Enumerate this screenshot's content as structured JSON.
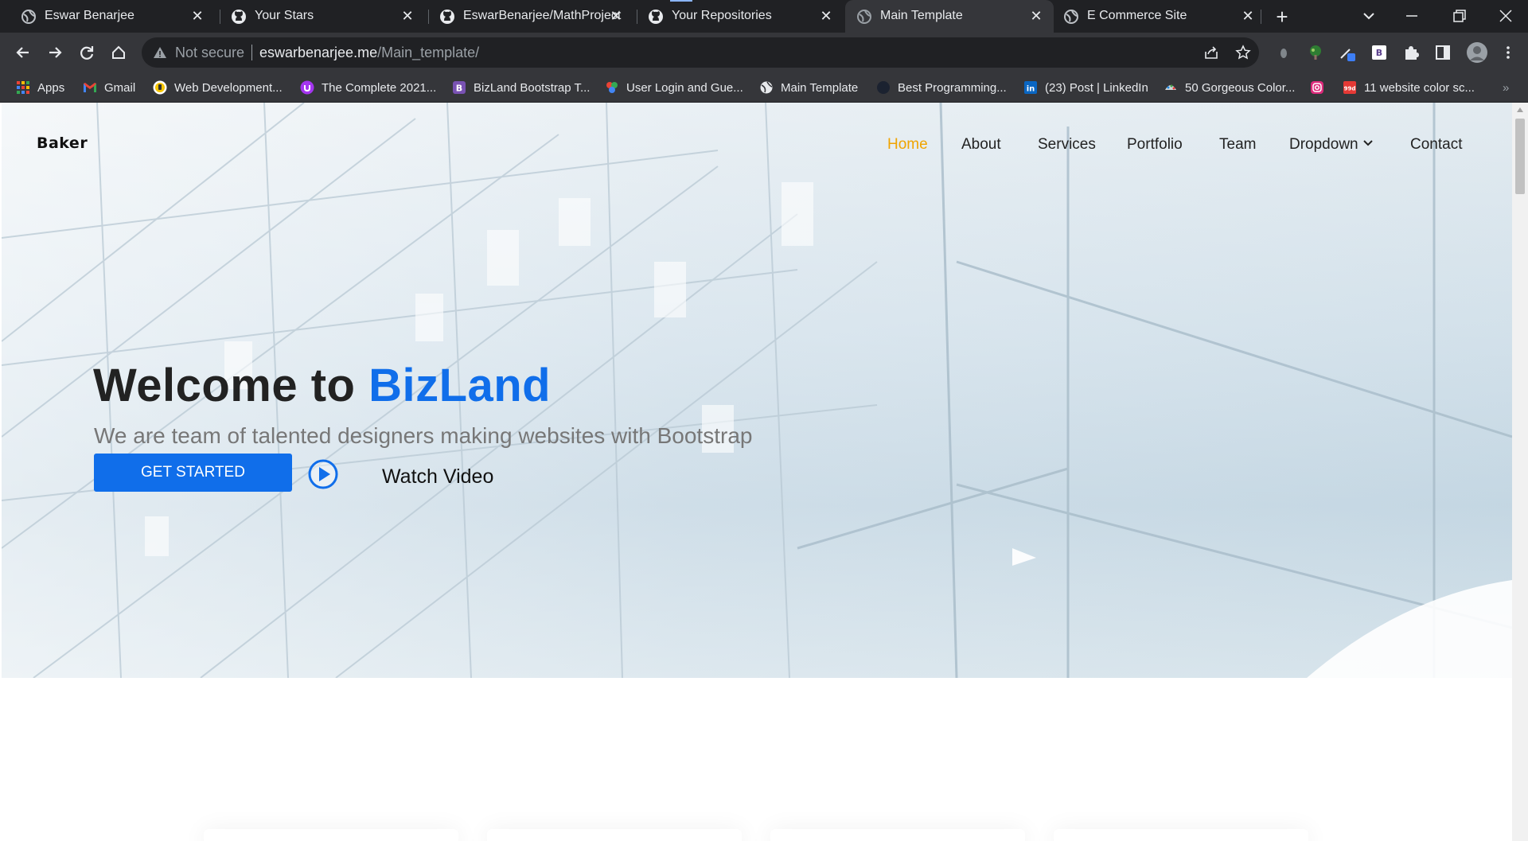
{
  "browser": {
    "tabs": [
      {
        "title": "Eswar Benarjee",
        "icon": "globe-icon",
        "active": false
      },
      {
        "title": "Your Stars",
        "icon": "github-icon",
        "active": false
      },
      {
        "title": "EswarBenarjee/MathProject",
        "icon": "github-icon",
        "active": false
      },
      {
        "title": "Your Repositories",
        "icon": "github-icon",
        "active": false
      },
      {
        "title": "Main Template",
        "icon": "globe-icon",
        "active": true
      },
      {
        "title": "E Commerce Site",
        "icon": "globe-icon",
        "active": false
      }
    ],
    "close_glyph": "✕",
    "new_tab_glyph": "+",
    "omnibox": {
      "security_label": "Not secure",
      "url_host": "eswarbenarjee.me",
      "url_path": "/Main_template/"
    },
    "bookmarks": [
      {
        "label": "Apps",
        "icon": "apps-grid-icon"
      },
      {
        "label": "Gmail",
        "icon": "gmail-icon"
      },
      {
        "label": "Web Development...",
        "icon": "udemy-icon"
      },
      {
        "label": "The Complete 2021...",
        "icon": "udemy-purple-icon"
      },
      {
        "label": "BizLand Bootstrap T...",
        "icon": "bootstrap-icon"
      },
      {
        "label": "User Login and Gue...",
        "icon": "colorful-logo-icon"
      },
      {
        "label": "Main Template",
        "icon": "globe-icon"
      },
      {
        "label": "Best Programming...",
        "icon": "dark-circle-icon"
      },
      {
        "label": "(23) Post | LinkedIn",
        "icon": "linkedin-icon"
      },
      {
        "label": "50 Gorgeous Color...",
        "icon": "palette-icon"
      },
      {
        "label": "",
        "icon": "instagram-icon"
      },
      {
        "label": "11 website color sc...",
        "icon": "red-square-icon"
      }
    ],
    "bookmarks_overflow": "»",
    "colors": {
      "chrome_dark": "#202124",
      "chrome_toolbar": "#35363a",
      "text": "#e8eaed"
    }
  },
  "site": {
    "logo": "Baker",
    "nav": [
      {
        "label": "Home",
        "active": true
      },
      {
        "label": "About",
        "active": false
      },
      {
        "label": "Services",
        "active": false
      },
      {
        "label": "Portfolio",
        "active": false
      },
      {
        "label": "Team",
        "active": false
      },
      {
        "label": "Dropdown",
        "active": false,
        "caret": "⌄"
      },
      {
        "label": "Contact",
        "active": false
      }
    ],
    "hero": {
      "title_prefix": "Welcome to ",
      "title_brand": "BizLand",
      "subtitle": "We are team of talented designers making websites with Bootstrap",
      "cta_label": "GET STARTED",
      "video_label": "Watch Video"
    },
    "colors": {
      "brand": "#106eea",
      "nav_active": "#f0a400",
      "text": "#222222"
    }
  }
}
